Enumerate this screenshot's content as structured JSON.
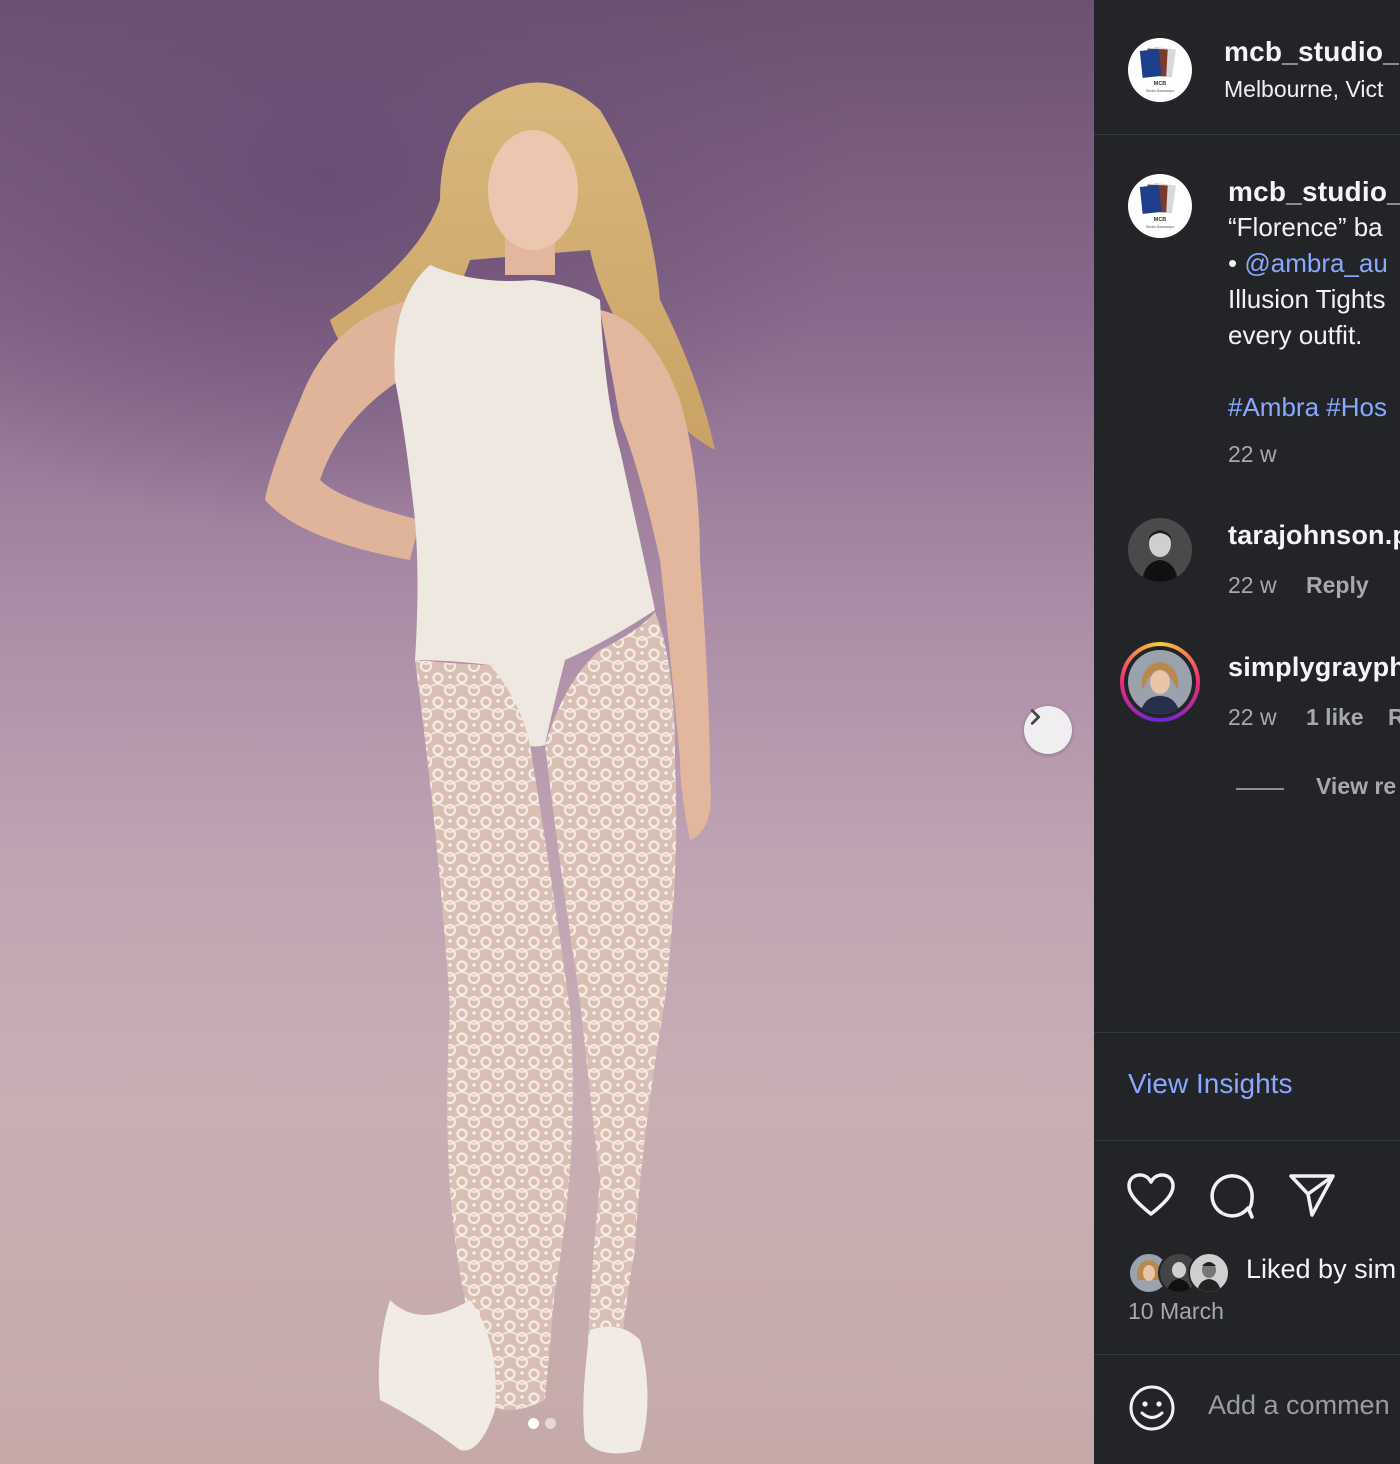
{
  "post": {
    "account": "mcb_studio_",
    "location": "Melbourne, Vict",
    "brand_logo_text": "MCB",
    "brand_logo_subtext": "Studio Backdrops",
    "carousel_dots": 2,
    "carousel_active_index": 0
  },
  "caption": {
    "username": "mcb_studio_",
    "line1": "“Florence” ba",
    "bullet": "•",
    "mention": "@ambra_au",
    "line3": "Illusion Tights",
    "line4": "every outfit.",
    "hashtags": "#Ambra #Hos",
    "time": "22 w"
  },
  "comments": [
    {
      "username": "tarajohnson.p",
      "time": "22 w",
      "reply": "Reply"
    },
    {
      "username": "simplygrayph",
      "time": "22 w",
      "likes": "1 like",
      "reply": "R"
    }
  ],
  "view_replies": "View re",
  "insights": "View Insights",
  "icons": [
    "heart-icon",
    "comment-icon",
    "share-icon",
    "emoji-icon",
    "chevron-right-icon"
  ],
  "liked_by": "Liked by sim",
  "date": "10 March",
  "add_comment_placeholder": "Add a commen",
  "colors": {
    "panel_bg": "#222428",
    "link": "#8aa8ff",
    "muted": "#a6a8ad"
  }
}
